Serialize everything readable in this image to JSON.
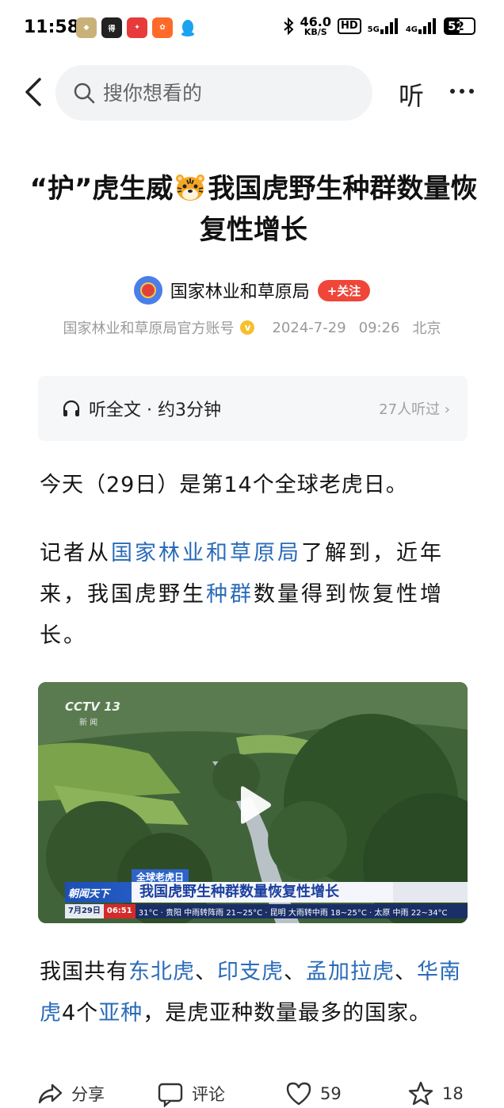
{
  "status_bar": {
    "time": "11:58",
    "net_speed": "46.0",
    "net_unit": "KB/S",
    "hd": "HD",
    "signal1": "5G",
    "signal2": "4G",
    "battery": "52"
  },
  "nav": {
    "search_placeholder": "搜你想看的",
    "listen_label": "听"
  },
  "article": {
    "headline_part1": "“护”虎生威",
    "headline_part2": "我国虎野生种群数量恢复性增长",
    "author": "国家林业和草原局",
    "follow_label": "+关注",
    "account_label": "国家林业和草原局官方账号",
    "date": "2024-7-29",
    "time": "09:26",
    "location": "北京"
  },
  "listen_bar": {
    "label": "听全文 · 约3分钟",
    "count": "27人听过 ›"
  },
  "body": {
    "p1": "今天（29日）是第14个全球老虎日。",
    "p2_a": "记者从",
    "p2_link1": "国家林业和草原局",
    "p2_b": "了解到，近年来，我国虎野生",
    "p2_link2": "种群",
    "p2_c": "数量得到恢复性增长。",
    "p3_a": "我国共有",
    "p3_link1": "东北虎",
    "p3_sep1": "、",
    "p3_link2": "印支虎",
    "p3_sep2": "、",
    "p3_link3": "孟加拉虎",
    "p3_sep3": "、",
    "p3_link4": "华南虎",
    "p3_b": "4个",
    "p3_link5": "亚种",
    "p3_c": "，是虎亚种数量最多的国家。"
  },
  "video": {
    "channel": "CCTV 13",
    "channel_sub": "新 闻",
    "tag": "全球老虎日",
    "brand": "朝闻天下",
    "title": "我国虎野生种群数量恢复性增长",
    "ticker_date": "7月29日",
    "ticker_time": "06:51",
    "ticker_weather": "31°C · 贵阳 中雨转阵雨 21~25°C · 昆明 大雨转中雨 18~25°C · 太原 中雨 22~34°C"
  },
  "actions": {
    "share": "分享",
    "comment": "评论",
    "likes": "59",
    "stars": "18"
  }
}
